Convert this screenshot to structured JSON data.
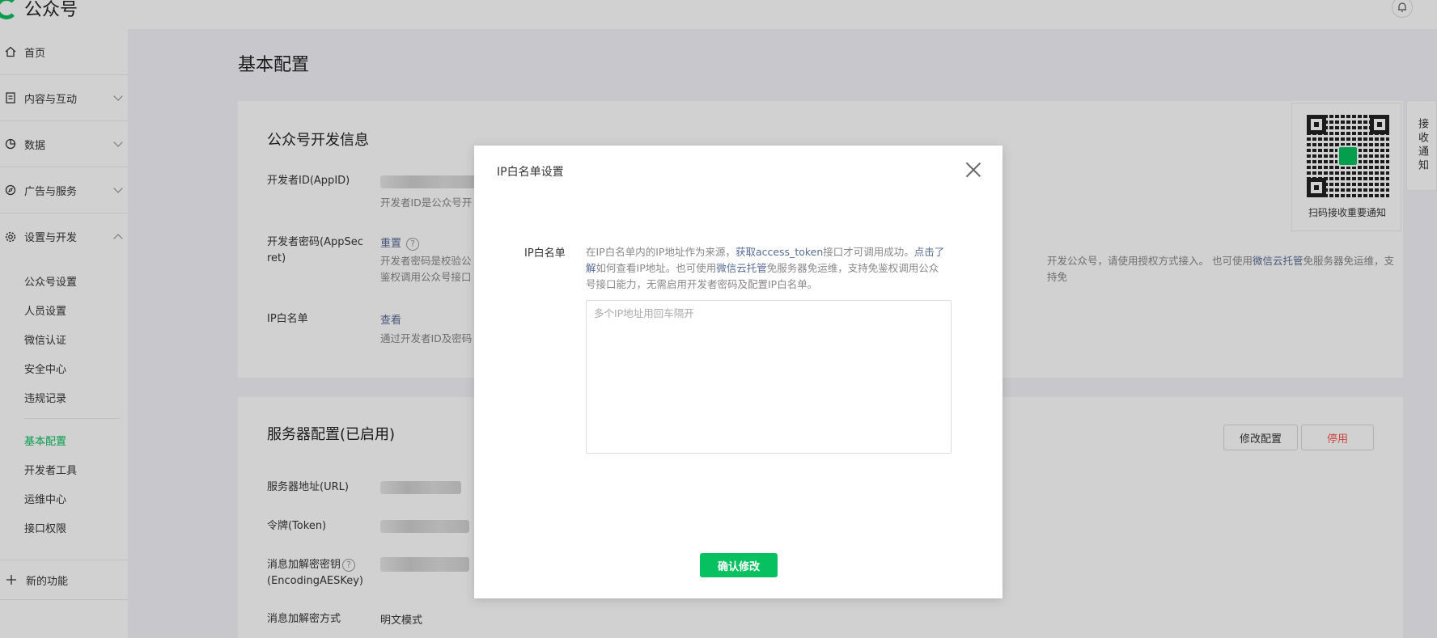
{
  "app": {
    "brand": "公众号"
  },
  "colors": {
    "accent": "#07c160",
    "link": "#576b95",
    "danger": "#fa5151"
  },
  "sidebar": {
    "groups": [
      {
        "label": "首页",
        "icon": "home-icon"
      },
      {
        "label": "内容与互动",
        "icon": "document-icon"
      },
      {
        "label": "数据",
        "icon": "pie-chart-icon"
      },
      {
        "label": "广告与服务",
        "icon": "compass-icon"
      },
      {
        "label": "设置与开发",
        "icon": "gear-icon"
      }
    ],
    "sub_items_a": [
      "公众号设置",
      "人员设置",
      "微信认证",
      "安全中心",
      "违规记录"
    ],
    "sub_items_b": [
      "基本配置",
      "开发者工具",
      "运维中心",
      "接口权限"
    ],
    "new_features": "新的功能"
  },
  "page": {
    "title": "基本配置"
  },
  "dev_info": {
    "title": "公众号开发信息",
    "appid_label": "开发者ID(AppID)",
    "appid_desc": "开发者ID是公众号开",
    "secret_label_1": "开发者密码(AppSec",
    "secret_label_2": "ret)",
    "secret_action": "重置",
    "secret_desc_1": "开发者密码是校验公",
    "secret_desc_2": "鉴权调用公众号接口",
    "right_desc_1_a": "开发公众号，请使用授权方式接入。 也可使用",
    "right_desc_1_link": "微信云托管",
    "right_desc_1_b": "免服务器免运维，支持免",
    "ip_label": "IP白名单",
    "ip_action": "查看",
    "ip_desc": "通过开发者ID及密码"
  },
  "server_config": {
    "title": "服务器配置(已启用)",
    "edit_button": "修改配置",
    "disable_button": "停用",
    "url_label": "服务器地址(URL)",
    "token_label": "令牌(Token)",
    "aes_label_1": "消息加解密密钥",
    "aes_label_2": "(EncodingAESKey)",
    "mode_label": "消息加解密方式",
    "mode_value": "明文模式"
  },
  "qr_widget": {
    "caption": "扫码接收重要通知",
    "side_tab": "接收通知"
  },
  "modal": {
    "title": "IP白名单设置",
    "field_label": "IP白名单",
    "desc_1": "在IP白名单内的IP地址作为来源，",
    "desc_link_1": "获取access_token",
    "desc_2": "接口才可调用成功。",
    "desc_link_2": "点击了解",
    "desc_3": "如何查看IP地址。也可使用",
    "desc_link_3": "微信云托管",
    "desc_4": "免服务器免运维，支持免鉴权调用公众号接口能力，无需启用开发者密码及配置IP白名单。",
    "textarea_placeholder": "多个IP地址用回车隔开",
    "textarea_value": "",
    "confirm_button": "确认修改"
  }
}
